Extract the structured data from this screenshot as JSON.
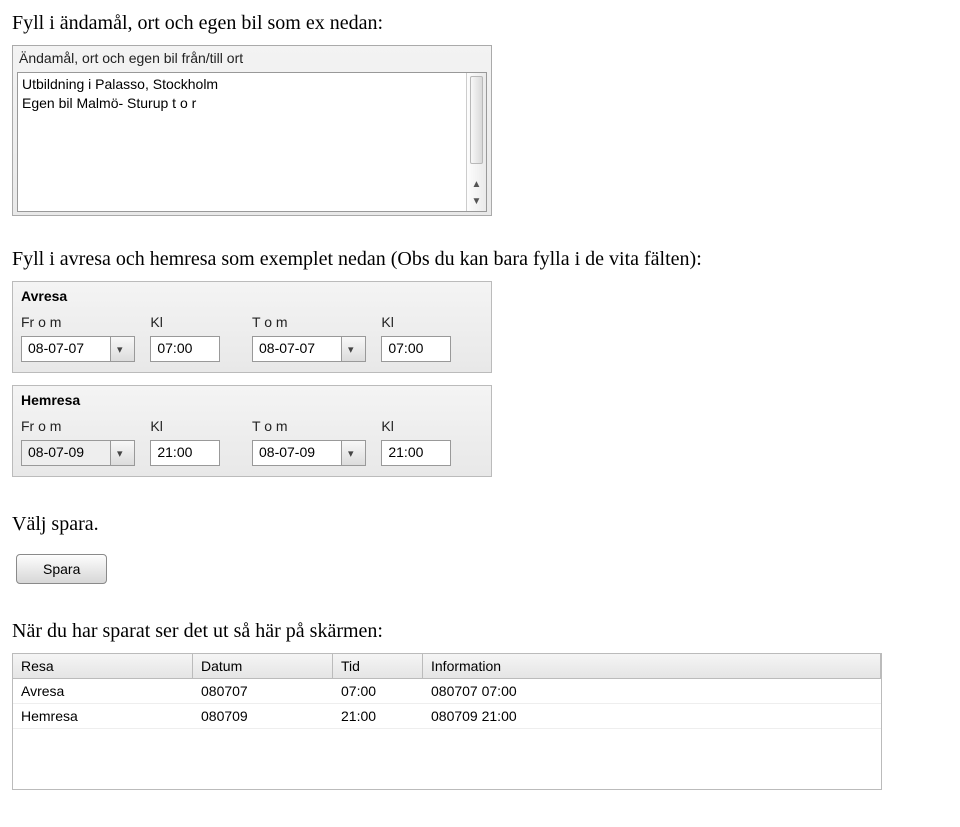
{
  "instr1": "Fyll i ändamål, ort och egen bil som ex nedan:",
  "textarea": {
    "label": "Ändamål, ort och egen bil från/till ort",
    "line1": "Utbildning i Palasso, Stockholm",
    "line2": "Egen bil Malmö- Sturup t o r"
  },
  "instr2": "Fyll i avresa och hemresa som exemplet nedan (Obs du kan bara fylla i de vita fälten):",
  "avresa": {
    "title": "Avresa",
    "from_lbl": "Fr o m",
    "kl_lbl": "Kl",
    "to_lbl": "T o m",
    "from_val": "08-07-07",
    "from_kl": "07:00",
    "to_val": "08-07-07",
    "to_kl": "07:00"
  },
  "hemresa": {
    "title": "Hemresa",
    "from_lbl": "Fr o m",
    "kl_lbl": "Kl",
    "to_lbl": "T o m",
    "from_val": "08-07-09",
    "from_kl": "21:00",
    "to_val": "08-07-09",
    "to_kl": "21:00"
  },
  "instr3": "Välj spara.",
  "save_btn": "Spara",
  "instr4": "När du har sparat ser det ut så här på skärmen:",
  "table": {
    "h1": "Resa",
    "h2": "Datum",
    "h3": "Tid",
    "h4": "Information",
    "rows": {
      "0": {
        "resa": "Avresa",
        "datum": "080707",
        "tid": "07:00",
        "info": "080707 07:00"
      },
      "1": {
        "resa": "Hemresa",
        "datum": "080709",
        "tid": "21:00",
        "info": "080709 21:00"
      }
    }
  }
}
